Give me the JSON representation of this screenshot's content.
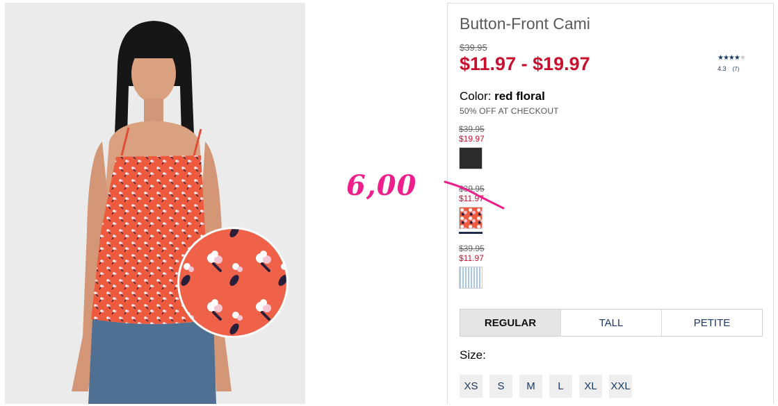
{
  "note": {
    "text": "6,00"
  },
  "product": {
    "title": "Button-Front Cami",
    "original_price": "$39.95",
    "sale_price": "$11.97 - $19.97",
    "rating": {
      "value": "4.3",
      "count": "(7)",
      "stars": 4.3
    },
    "color_label": "Color:",
    "color_value": "red floral",
    "promo": "50% OFF AT CHECKOUT"
  },
  "swatches": [
    {
      "was": "$39.95",
      "now": "$19.97",
      "color": "#2b2b2b"
    },
    {
      "was": "$39.95",
      "now": "$11.97",
      "color": "#ee5a3e",
      "selected": true
    },
    {
      "was": "$39.95",
      "now": "$11.97",
      "color": "#a9c6ef"
    }
  ],
  "fit_tabs": [
    "REGULAR",
    "TALL",
    "PETITE"
  ],
  "size_label": "Size:",
  "sizes": [
    "XS",
    "S",
    "M",
    "L",
    "XL",
    "XXL"
  ],
  "colors": {
    "sale_red": "#c8102e",
    "link_blue": "#173a65",
    "note_pink": "#ee1f8c"
  },
  "icons": {
    "rating": "star-icon"
  }
}
